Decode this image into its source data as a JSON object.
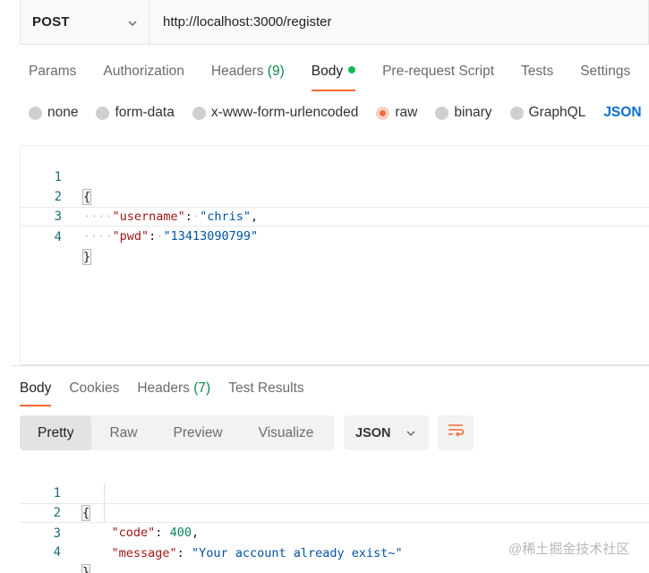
{
  "request": {
    "method": "POST",
    "url": "http://localhost:3000/register"
  },
  "request_tabs": [
    {
      "label": "Params"
    },
    {
      "label": "Authorization"
    },
    {
      "label": "Headers",
      "count": "(9)"
    },
    {
      "label": "Body",
      "active": true
    },
    {
      "label": "Pre-request Script"
    },
    {
      "label": "Tests"
    },
    {
      "label": "Settings"
    }
  ],
  "body_types": {
    "none": "none",
    "form_data": "form-data",
    "urlencoded": "x-www-form-urlencoded",
    "raw": "raw",
    "binary": "binary",
    "graphql": "GraphQL",
    "format": "JSON",
    "selected": "raw"
  },
  "request_body": {
    "line_numbers": [
      "1",
      "2",
      "3",
      "4"
    ],
    "open_brace": "{",
    "close_brace": "}",
    "fields": [
      {
        "key": "\"username\"",
        "value": "\"chris\"",
        "trail": ","
      },
      {
        "key": "\"pwd\"",
        "value": "\"13413090799\"",
        "trail": ""
      }
    ]
  },
  "response_tabs": [
    {
      "label": "Body",
      "active": true
    },
    {
      "label": "Cookies"
    },
    {
      "label": "Headers",
      "count": "(7)"
    },
    {
      "label": "Test Results"
    }
  ],
  "response_toolbar": {
    "views": [
      "Pretty",
      "Raw",
      "Preview",
      "Visualize"
    ],
    "active_view": "Pretty",
    "language": "JSON"
  },
  "response_body": {
    "line_numbers": [
      "1",
      "2",
      "3",
      "4"
    ],
    "open_brace": "{",
    "close_brace": "}",
    "code_key": "\"code\"",
    "code_value": "400",
    "message_key": "\"message\"",
    "message_value": "\"Your account already exist~\""
  },
  "watermark": "@稀土掘金技术社区",
  "colors": {
    "accent": "#f26b3a",
    "active_dot": "#0cbb52",
    "link": "#0a6ed1",
    "json_key": "#a31515",
    "json_string": "#0451a5",
    "json_number": "#098658"
  }
}
